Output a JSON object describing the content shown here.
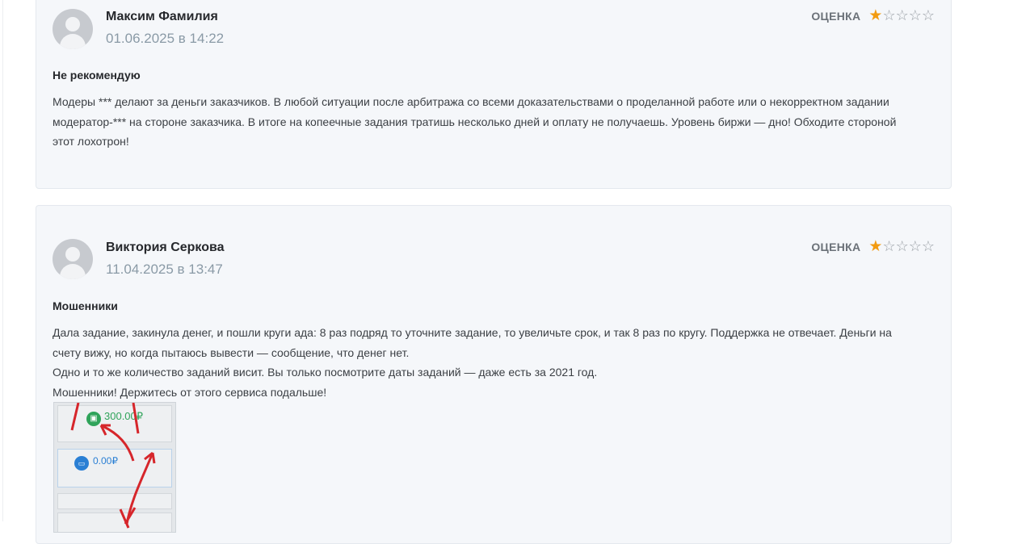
{
  "reviews": [
    {
      "author": "Максим Фамилия",
      "date": "01.06.2025 в 14:22",
      "rating_label": "ОЦЕНКА",
      "rating": 1,
      "rating_max": 5,
      "title": "Не рекомендую",
      "paragraphs": [
        "Модеры *** делают за деньги заказчиков. В любой ситуации после арбитража со всеми доказательствами о проделанной работе или о некорректном задании модератор-*** на стороне заказчика. В итоге на копеечные задания тратишь несколько дней и оплату не получаешь. Уровень биржи — дно! Обходите стороной этот лохотрон!"
      ]
    },
    {
      "author": "Виктория Серкова",
      "date": "11.04.2025 в 13:47",
      "rating_label": "ОЦЕНКА",
      "rating": 1,
      "rating_max": 5,
      "title": "Мошенники",
      "paragraphs": [
        "Дала задание, закинула денег, и пошли круги ада: 8 раз подряд то уточните задание, то увеличьте срок, и так 8 раз по кругу. Поддержка не отвечает. Деньги на счету вижу, но когда пытаюсь вывести — сообщение, что денег нет.",
        "Одно и то же количество заданий висит. Вы только посмотрите даты заданий — даже есть за 2021 год.",
        "Мошенники! Держитесь от этого сервиса подальше!"
      ],
      "attachment": {
        "amount_1": "300.00₽",
        "amount_2": "0.00₽"
      }
    }
  ],
  "colors": {
    "star_filled": "#f29b11",
    "star_empty": "#9aa0a6",
    "date": "#8a9aa6",
    "card_bg": "#f5f7fa"
  },
  "icons": {
    "avatar": "user-avatar-icon",
    "star": "star-icon"
  }
}
